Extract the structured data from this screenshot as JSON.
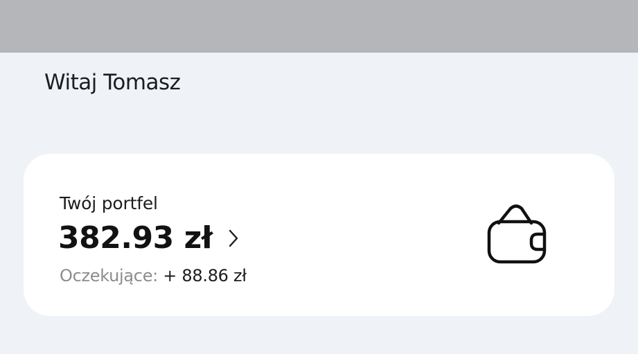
{
  "greeting": "Witaj Tomasz",
  "wallet": {
    "title": "Twój portfel",
    "balance": "382.93 zł",
    "pending_label": "Oczekujące:",
    "pending_value": "+ 88.86 zł",
    "icon": "wallet-icon",
    "chevron_icon": "chevron-right-icon"
  },
  "colors": {
    "background": "#eff3f8",
    "status_bar": "#b5b6b9",
    "card": "#ffffff",
    "muted_text": "#8c8c8f",
    "primary_text": "#121212"
  }
}
